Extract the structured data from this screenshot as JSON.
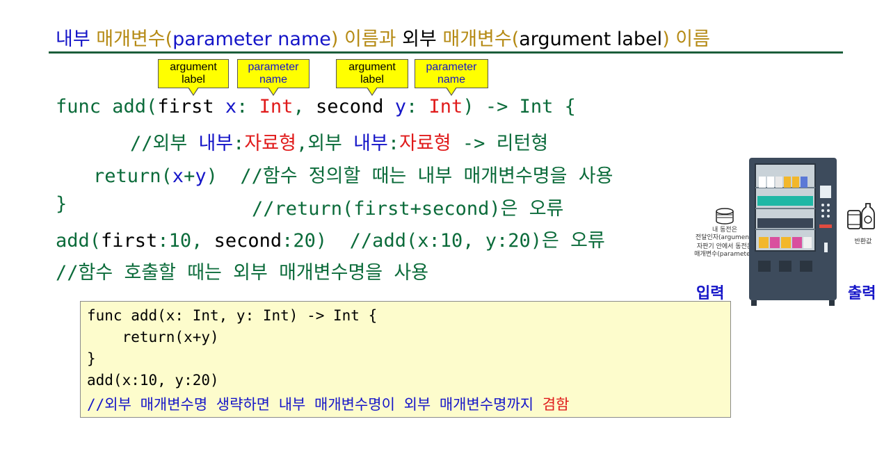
{
  "title": {
    "part1": "내부 ",
    "part2": "매개변수(",
    "part3": "parameter name",
    "part4": ") 이름과 ",
    "part5": "외부 ",
    "part6": "매개변수(",
    "part7": "argument label",
    "part8": ") 이름"
  },
  "callouts": [
    {
      "line1": "argument",
      "line2": "label"
    },
    {
      "line1": "parameter",
      "line2": "name"
    },
    {
      "line1": "argument",
      "line2": "label"
    },
    {
      "line1": "parameter",
      "line2": "name"
    }
  ],
  "code": {
    "l1": {
      "a": "func add(",
      "b": "first",
      "c": " ",
      "d": "x",
      "e": ": ",
      "f": "Int",
      "g": ", ",
      "h": "second",
      "i": " ",
      "j": "y",
      "k": ": ",
      "l": "Int",
      "m": ") -> Int {"
    },
    "l2": {
      "a": "//외부 ",
      "b": "내부",
      "c": ":",
      "d": "자료형",
      "e": ",외부 ",
      "f": "내부",
      "g": ":",
      "h": "자료형",
      "i": " -> 리턴형"
    },
    "l3": {
      "a": "return(",
      "b": "x",
      "c": "+",
      "d": "y",
      "e": ")  //함수 정의할 때는 내부 매개변수명을 사용"
    },
    "l4": {
      "a": "}",
      "b": "//return(first+second)은 오류"
    },
    "l5": {
      "a": "add(",
      "b": "first",
      "c": ":10, ",
      "d": "second",
      "e": ":20)  //add(x:10, y:20)은 오류"
    },
    "l6": {
      "a": "//함수 호출할 때는 외부 매개변수명을 사용"
    }
  },
  "box": {
    "lines": [
      "func add(x: Int, y: Int) -> Int {",
      "    return(x+y)",
      "}",
      "add(x:10, y:20)"
    ],
    "comment": "//외부 매개변수명 생략하면 내부 매개변수명이 외부 매개변수명까지 ",
    "comment_red": "겸함"
  },
  "diagram": {
    "coin_label_1": "내 동전은",
    "coin_label_2": "전달인자(argument)",
    "coin_label_3": "자판기 안에서 동전은",
    "coin_label_4": "매개변수(parameter)",
    "return_label": "반환값",
    "input_label": "입력",
    "output_label": "출력"
  }
}
